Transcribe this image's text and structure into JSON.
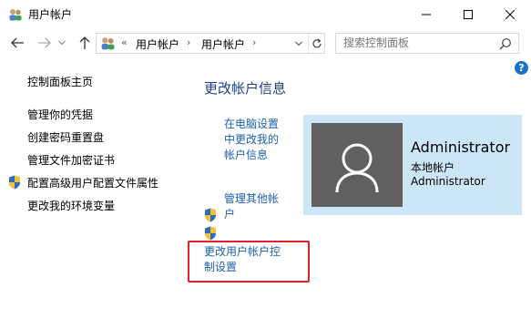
{
  "window": {
    "title": "用户帐户",
    "controls": {
      "minimize": "minimize",
      "maximize": "maximize",
      "close": "close"
    }
  },
  "navigation": {
    "breadcrumb_overflow": "«",
    "breadcrumbs": [
      "用户帐户",
      "用户帐户"
    ],
    "search_placeholder": "搜索控制面板"
  },
  "sidebar": {
    "home": "控制面板主页",
    "items": [
      {
        "label": "管理你的凭据",
        "shield": false
      },
      {
        "label": "创建密码重置盘",
        "shield": false
      },
      {
        "label": "管理文件加密证书",
        "shield": false
      },
      {
        "label": "配置高级用户配置文件属性",
        "shield": true
      },
      {
        "label": "更改我的环境变量",
        "shield": false
      }
    ]
  },
  "main": {
    "title": "更改帐户信息",
    "link_pc_settings_lines": [
      "在电脑设置",
      "中更改我的",
      "帐户信息"
    ],
    "link_manage_other_lines": [
      "管理其他帐",
      "户"
    ],
    "link_uac_lines": [
      "更改用户帐户控",
      "制设置"
    ]
  },
  "user": {
    "name": "Administrator",
    "type": "本地帐户",
    "subtitle": "Administrator"
  },
  "colors": {
    "link": "#1e5fb4",
    "title": "#1e3f8f",
    "card_bg": "#cde6f7",
    "avatar_bg": "#606060",
    "highlight": "#e0202a"
  },
  "icons": {
    "app": "users-icon",
    "shield": "uac-shield-icon",
    "help": "help-icon",
    "search": "search-icon",
    "refresh": "refresh-icon"
  }
}
